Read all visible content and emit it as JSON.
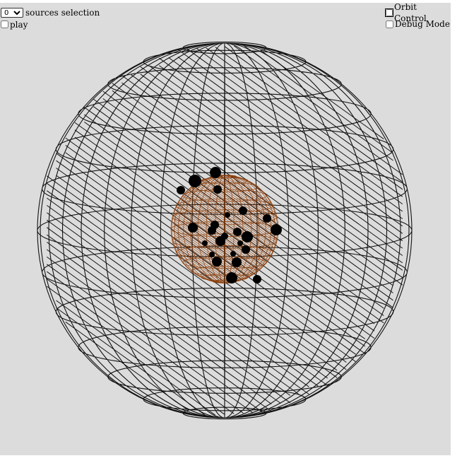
{
  "controls": {
    "sources_select": {
      "selected": "0",
      "options": [
        "0"
      ],
      "label": "sources selection"
    },
    "play": {
      "label": "play",
      "checked": false
    },
    "orbit_control": {
      "label": "Orbit Control",
      "checked": false
    },
    "debug_mode": {
      "label": "Debug Mode",
      "checked": false
    }
  },
  "scene": {
    "background_color": "#dcdcdc",
    "outer_sphere_color": "#111111",
    "inner_sphere_color": "#8b3f0c",
    "source_marker_color": "#000000",
    "source_count": 24
  }
}
